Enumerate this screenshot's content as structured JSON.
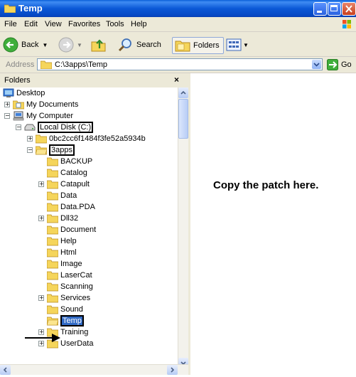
{
  "window": {
    "title": "Temp"
  },
  "menu": [
    "File",
    "Edit",
    "View",
    "Favorites",
    "Tools",
    "Help"
  ],
  "toolbar": {
    "back": "Back",
    "search": "Search",
    "folders": "Folders"
  },
  "address": {
    "label": "Address",
    "value": "C:\\3apps\\Temp",
    "go": "Go"
  },
  "folders_pane": {
    "title": "Folders",
    "close": "×"
  },
  "tree": {
    "desktop": "Desktop",
    "my_documents": "My Documents",
    "my_computer": "My Computer",
    "local_disk": "Local Disk (C:)",
    "guid_folder": "0bc2cc6f1484f3fe52a5934b",
    "apps": "3apps",
    "children": [
      "BACKUP",
      "Catalog",
      "Catapult",
      "Data",
      "Data.PDA",
      "Dll32",
      "Document",
      "Help",
      "Html",
      "Image",
      "LaserCat",
      "Scanning",
      "Services",
      "Sound",
      "Temp",
      "Training",
      "UserData"
    ]
  },
  "instruction": "Copy the patch here.",
  "colors": {
    "titlebar": "#0a58d6",
    "selection": "#316ac5",
    "chrome": "#ece9d8",
    "folder": "#f5d55b"
  }
}
